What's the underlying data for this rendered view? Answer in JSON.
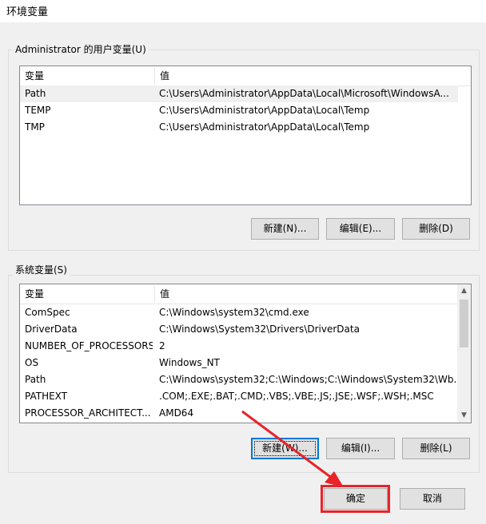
{
  "window": {
    "title": "环境变量"
  },
  "user_vars": {
    "group_label": "Administrator 的用户变量(U)",
    "columns": [
      "变量",
      "值"
    ],
    "rows": [
      {
        "name": "Path",
        "value": "C:\\Users\\Administrator\\AppData\\Local\\Microsoft\\WindowsA..."
      },
      {
        "name": "TEMP",
        "value": "C:\\Users\\Administrator\\AppData\\Local\\Temp"
      },
      {
        "name": "TMP",
        "value": "C:\\Users\\Administrator\\AppData\\Local\\Temp"
      }
    ],
    "buttons": {
      "new": "新建(N)...",
      "edit": "编辑(E)...",
      "delete": "删除(D)"
    }
  },
  "system_vars": {
    "group_label": "系统变量(S)",
    "columns": [
      "变量",
      "值"
    ],
    "rows": [
      {
        "name": "ComSpec",
        "value": "C:\\Windows\\system32\\cmd.exe"
      },
      {
        "name": "DriverData",
        "value": "C:\\Windows\\System32\\Drivers\\DriverData"
      },
      {
        "name": "NUMBER_OF_PROCESSORS",
        "value": "2"
      },
      {
        "name": "OS",
        "value": "Windows_NT"
      },
      {
        "name": "Path",
        "value": "C:\\Windows\\system32;C:\\Windows;C:\\Windows\\System32\\Wb..."
      },
      {
        "name": "PATHEXT",
        "value": ".COM;.EXE;.BAT;.CMD;.VBS;.VBE;.JS;.JSE;.WSF;.WSH;.MSC"
      },
      {
        "name": "PROCESSOR_ARCHITECT...",
        "value": "AMD64"
      }
    ],
    "buttons": {
      "new": "新建(W)...",
      "edit": "编辑(I)...",
      "delete": "删除(L)"
    }
  },
  "footer": {
    "ok": "确定",
    "cancel": "取消"
  },
  "colors": {
    "annotation": "#e8232a",
    "focus": "#0078d7"
  }
}
